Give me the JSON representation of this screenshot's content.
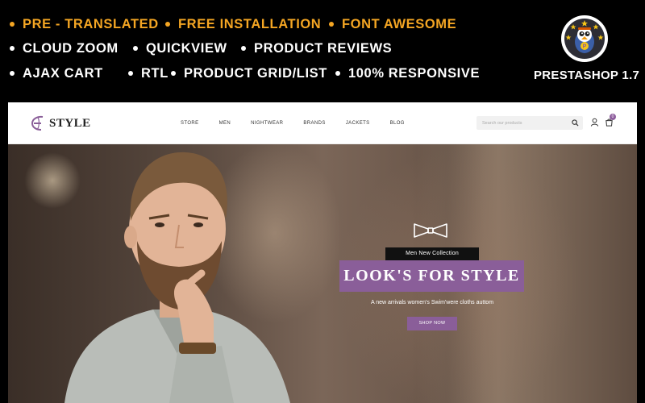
{
  "features": {
    "row1": [
      "PRE - TRANSLATED",
      "FREE INSTALLATION",
      "FONT AWESOME"
    ],
    "row2": [
      "CLOUD ZOOM",
      "QUICKVIEW",
      "PRODUCT REVIEWS"
    ],
    "row3": [
      "AJAX CART",
      "RTL",
      "PRODUCT GRID/LIST",
      "100% RESPONSIVE"
    ],
    "row1_color": "#f5a623",
    "other_color": "#ffffff"
  },
  "platform_label": "PRESTASHOP 1.7",
  "store": {
    "logo_text": "STYLE",
    "nav": [
      "STORE",
      "MEN",
      "NIGHTWEAR",
      "BRANDS",
      "JACKETS",
      "BLOG"
    ],
    "search_placeholder": "Search our products",
    "cart_count": "0",
    "accent_color": "#8a5e99"
  },
  "hero": {
    "tag": "Men New Collection",
    "title": "LOOK'S FOR STYLE",
    "subtitle": "A new arrivals women's Swim'were cloths auttom",
    "cta": "SHOP NOW"
  },
  "icons": [
    "prestashop-badge-icon",
    "logo-mark-icon",
    "search-icon",
    "user-icon",
    "cart-icon",
    "bowtie-icon"
  ]
}
